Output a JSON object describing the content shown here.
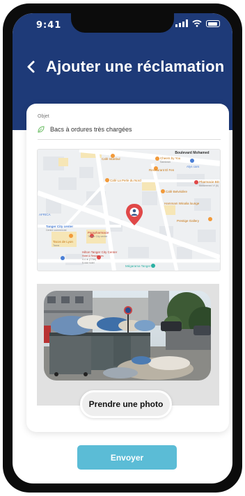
{
  "status_bar": {
    "time": "9:41"
  },
  "header": {
    "title": "Ajouter une réclamation"
  },
  "form": {
    "subject_label": "Objet",
    "subject_value": "Bacs à ordures très chargées"
  },
  "map": {
    "labels": {
      "street": "Boulevard Mohamed",
      "cheers": "Cheers by You",
      "cheers_sub": "Sandwich",
      "alys": "Alys cars",
      "cafe_istanbul": "Café Istanbul",
      "restaurant": "Restaurant El Fen",
      "perle": "Café La Perle du Nord",
      "pharmacie_bd": "Pharmacie BD",
      "pharmacie_bd_sub": "Mohammed VI (6)",
      "belvedere": "Café Belvédère",
      "hammam": "Hammam Winalia lounge",
      "africa": "AFRICA",
      "tanger_center": "Tanger City center",
      "tanger_center_sub": "Centre commercial",
      "parapharmacie": "Parapharmacie",
      "parapharmacie_sub": "Tanger City center",
      "prestige": "Prestige Gallery",
      "tacos": "Tacos de Lyon",
      "tacos_sub": "Tacos",
      "hilton": "Hilton Tanger City Center",
      "hilton_sub": "Hotel & Residences",
      "hilton_rating": "4.4 ★ (7756)",
      "hilton_type": "5-star hotel",
      "megarama": "Mégarama Tanger"
    }
  },
  "photo": {
    "button_label": "Prendre une photo"
  },
  "submit": {
    "label": "Envoyer"
  },
  "colors": {
    "header": "#1e3a78",
    "accent": "#5bbcd6",
    "leaf": "#7cc576",
    "pin": "#e04848"
  }
}
